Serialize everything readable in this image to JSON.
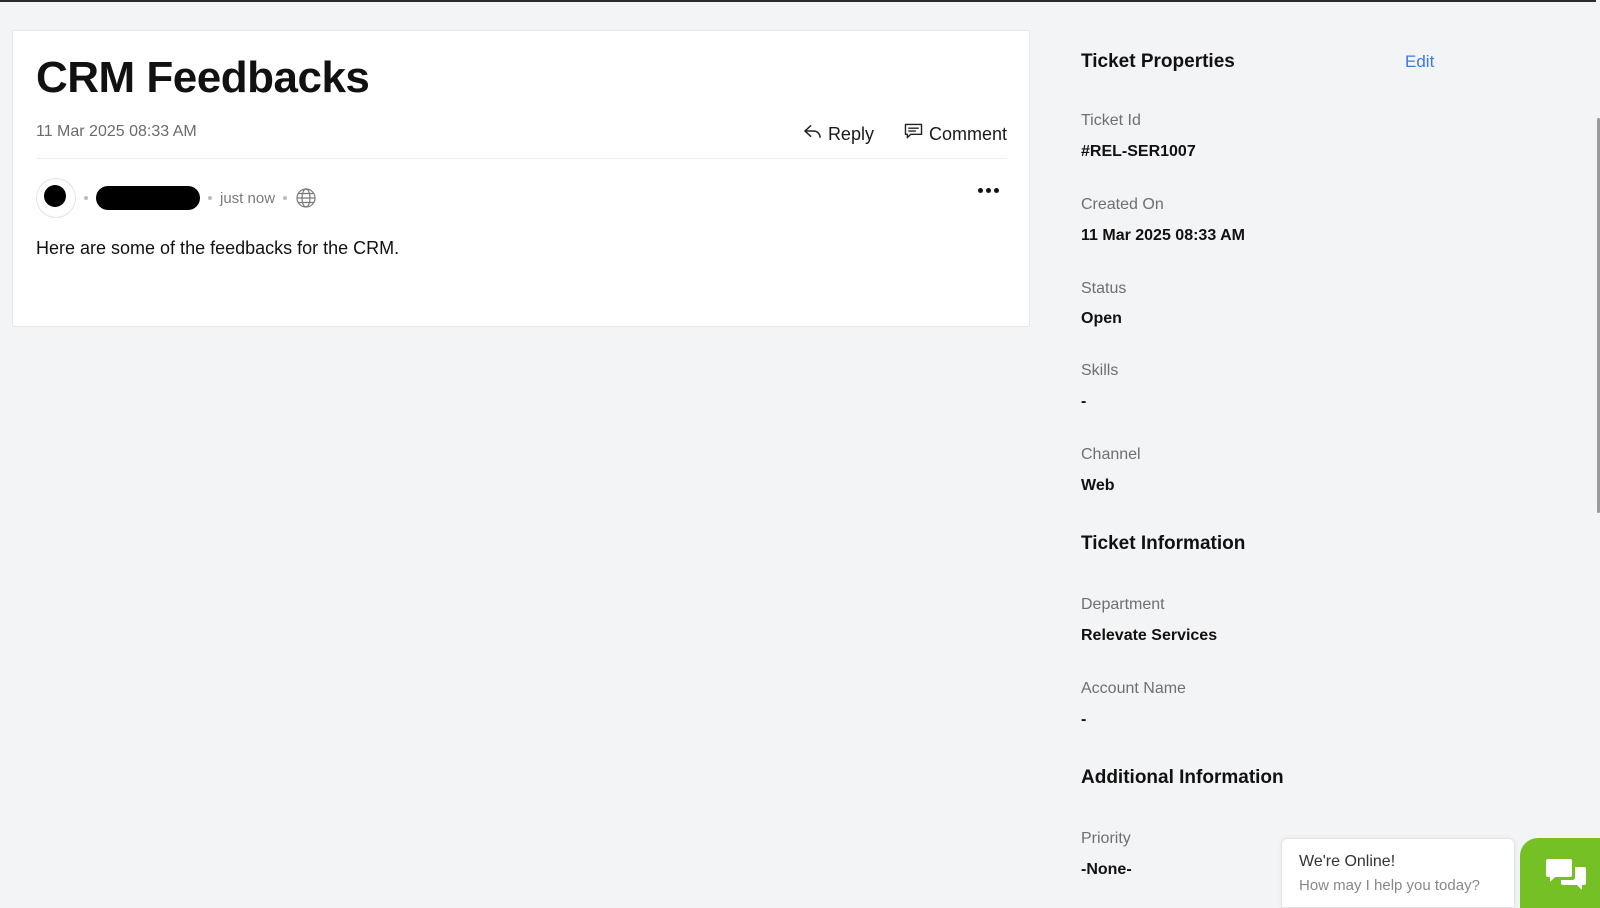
{
  "ticket": {
    "title": "CRM Feedbacks",
    "created": "11 Mar 2025 08:33 AM",
    "actions": {
      "reply_label": "Reply",
      "comment_label": "Comment"
    },
    "thread": {
      "time": "just now",
      "body": "Here are some of the feedbacks for the CRM."
    }
  },
  "properties": {
    "title": "Ticket Properties",
    "edit_label": "Edit",
    "ticket_id_label": "Ticket Id",
    "ticket_id": "#REL-SER1007",
    "created_on_label": "Created On",
    "created_on": "11 Mar 2025 08:33 AM",
    "status_label": "Status",
    "status": "Open",
    "skills_label": "Skills",
    "skills": "-",
    "channel_label": "Channel",
    "channel": "Web"
  },
  "ticket_information": {
    "title": "Ticket Information",
    "department_label": "Department",
    "department": "Relevate Services",
    "account_label": "Account Name",
    "account": "-"
  },
  "additional_information": {
    "title": "Additional Information",
    "priority_label": "Priority",
    "priority": "-None-"
  },
  "chat": {
    "title": "We're Online!",
    "subtitle": "How may I help you today?",
    "accent": "#74c025"
  },
  "colors": {
    "link": "#3a7be0",
    "background": "#f3f4f6"
  }
}
